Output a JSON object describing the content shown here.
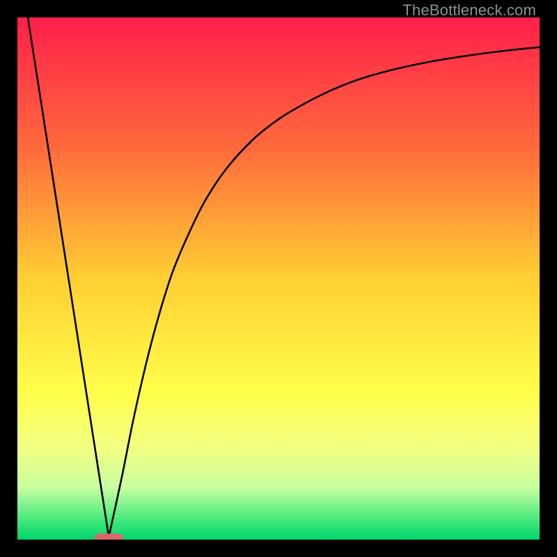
{
  "watermark": "TheBottleneck.com",
  "chart_data": {
    "type": "line",
    "title": "",
    "xlabel": "",
    "ylabel": "",
    "xlim": [
      0,
      100
    ],
    "ylim": [
      0,
      100
    ],
    "gradient_stops": [
      {
        "offset": 0.0,
        "color": "#ff1f4b"
      },
      {
        "offset": 0.25,
        "color": "#ff6a3c"
      },
      {
        "offset": 0.5,
        "color": "#ffcf33"
      },
      {
        "offset": 0.72,
        "color": "#ffff4a"
      },
      {
        "offset": 0.82,
        "color": "#f5ff80"
      },
      {
        "offset": 0.9,
        "color": "#c8ffa0"
      },
      {
        "offset": 0.965,
        "color": "#3fe87a"
      },
      {
        "offset": 1.0,
        "color": "#00d66b"
      }
    ],
    "optimal_marker": {
      "x": 17.5,
      "y": 0.5,
      "w": 5.5,
      "h": 1.3,
      "rx": 0.8,
      "color": "#d86a6a"
    },
    "series": [
      {
        "name": "left",
        "type": "line",
        "x": [
          2.0,
          17.5
        ],
        "y": [
          100.0,
          0.5
        ]
      },
      {
        "name": "right",
        "type": "curve",
        "x": [
          17.5,
          20,
          22,
          24,
          26,
          28,
          30,
          33,
          36,
          40,
          45,
          50,
          55,
          60,
          65,
          70,
          75,
          80,
          85,
          90,
          95,
          100
        ],
        "y": [
          0.5,
          12,
          22,
          31,
          39,
          46,
          52,
          59,
          65,
          71,
          76.5,
          80.5,
          83.5,
          86,
          88,
          89.5,
          90.7,
          91.7,
          92.5,
          93.2,
          93.8,
          94.3
        ]
      }
    ]
  }
}
